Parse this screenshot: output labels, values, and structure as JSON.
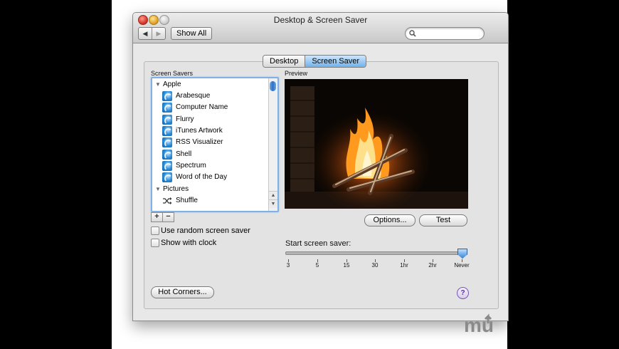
{
  "window": {
    "title": "Desktop & Screen Saver"
  },
  "toolbar": {
    "back": "◀",
    "forward": "▶",
    "show_all": "Show All",
    "search_placeholder": ""
  },
  "tabs": [
    {
      "label": "Desktop",
      "active": false
    },
    {
      "label": "Screen Saver",
      "active": true
    }
  ],
  "list": {
    "heading": "Screen Savers",
    "groups": [
      {
        "label": "Apple",
        "items": [
          "Arabesque",
          "Computer Name",
          "Flurry",
          "iTunes Artwork",
          "RSS Visualizer",
          "Shell",
          "Spectrum",
          "Word of the Day"
        ]
      },
      {
        "label": "Pictures",
        "items": [
          "Shuffle"
        ]
      }
    ],
    "add": "+",
    "remove": "−"
  },
  "options": {
    "random_label": "Use random screen saver",
    "random_checked": false,
    "clock_label": "Show with clock",
    "clock_checked": false
  },
  "preview": {
    "label": "Preview",
    "options_button": "Options...",
    "test_button": "Test"
  },
  "slider": {
    "label": "Start screen saver:",
    "ticks": [
      "3",
      "5",
      "15",
      "30",
      "1hr",
      "2hr",
      "Never"
    ],
    "selected": "Never"
  },
  "footer": {
    "hot_corners": "Hot Corners...",
    "help": "?"
  },
  "watermark": {
    "text": "mu"
  },
  "colors": {
    "selection_blue": "#6fb2ec",
    "help_purple": "#5a2d9c"
  }
}
